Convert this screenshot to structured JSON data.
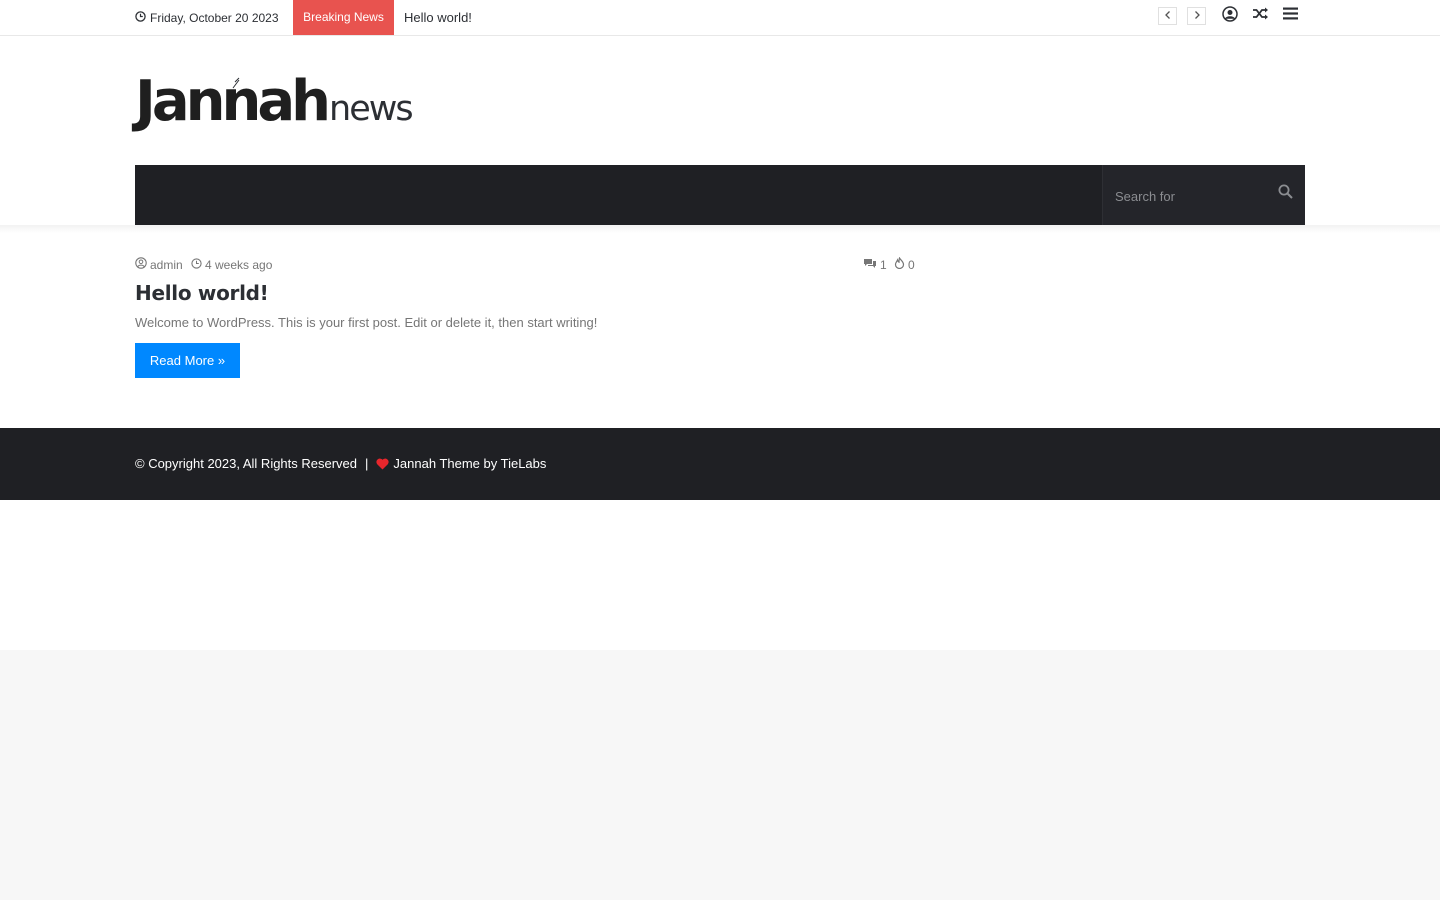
{
  "topbar": {
    "date": "Friday, October 20 2023",
    "breaking_label": "Breaking News",
    "ticker_item": "Hello world!",
    "prev_icon": "chevron-left-icon",
    "next_icon": "chevron-right-icon",
    "login_icon": "user-circle-icon",
    "random_icon": "shuffle-icon",
    "menu_icon": "bars-icon"
  },
  "header": {
    "logo_brand": "Jannah",
    "logo_suffix": "news"
  },
  "nav": {
    "search_placeholder": "Search for"
  },
  "post": {
    "author": "admin",
    "time": "4 weeks ago",
    "comments": "1",
    "views": "0",
    "title": "Hello world!",
    "excerpt": "Welcome to WordPress. This is your first post. Edit or delete it, then start writing!",
    "read_more": "Read More »"
  },
  "footer": {
    "copyright": "© Copyright 2023, All Rights Reserved",
    "separator": "|",
    "theme_link": "Jannah Theme by TieLabs"
  },
  "colors": {
    "breaking": "#e8534f",
    "nav_bg": "#1f2024",
    "button": "#0088ff",
    "heart": "#e8262c"
  }
}
